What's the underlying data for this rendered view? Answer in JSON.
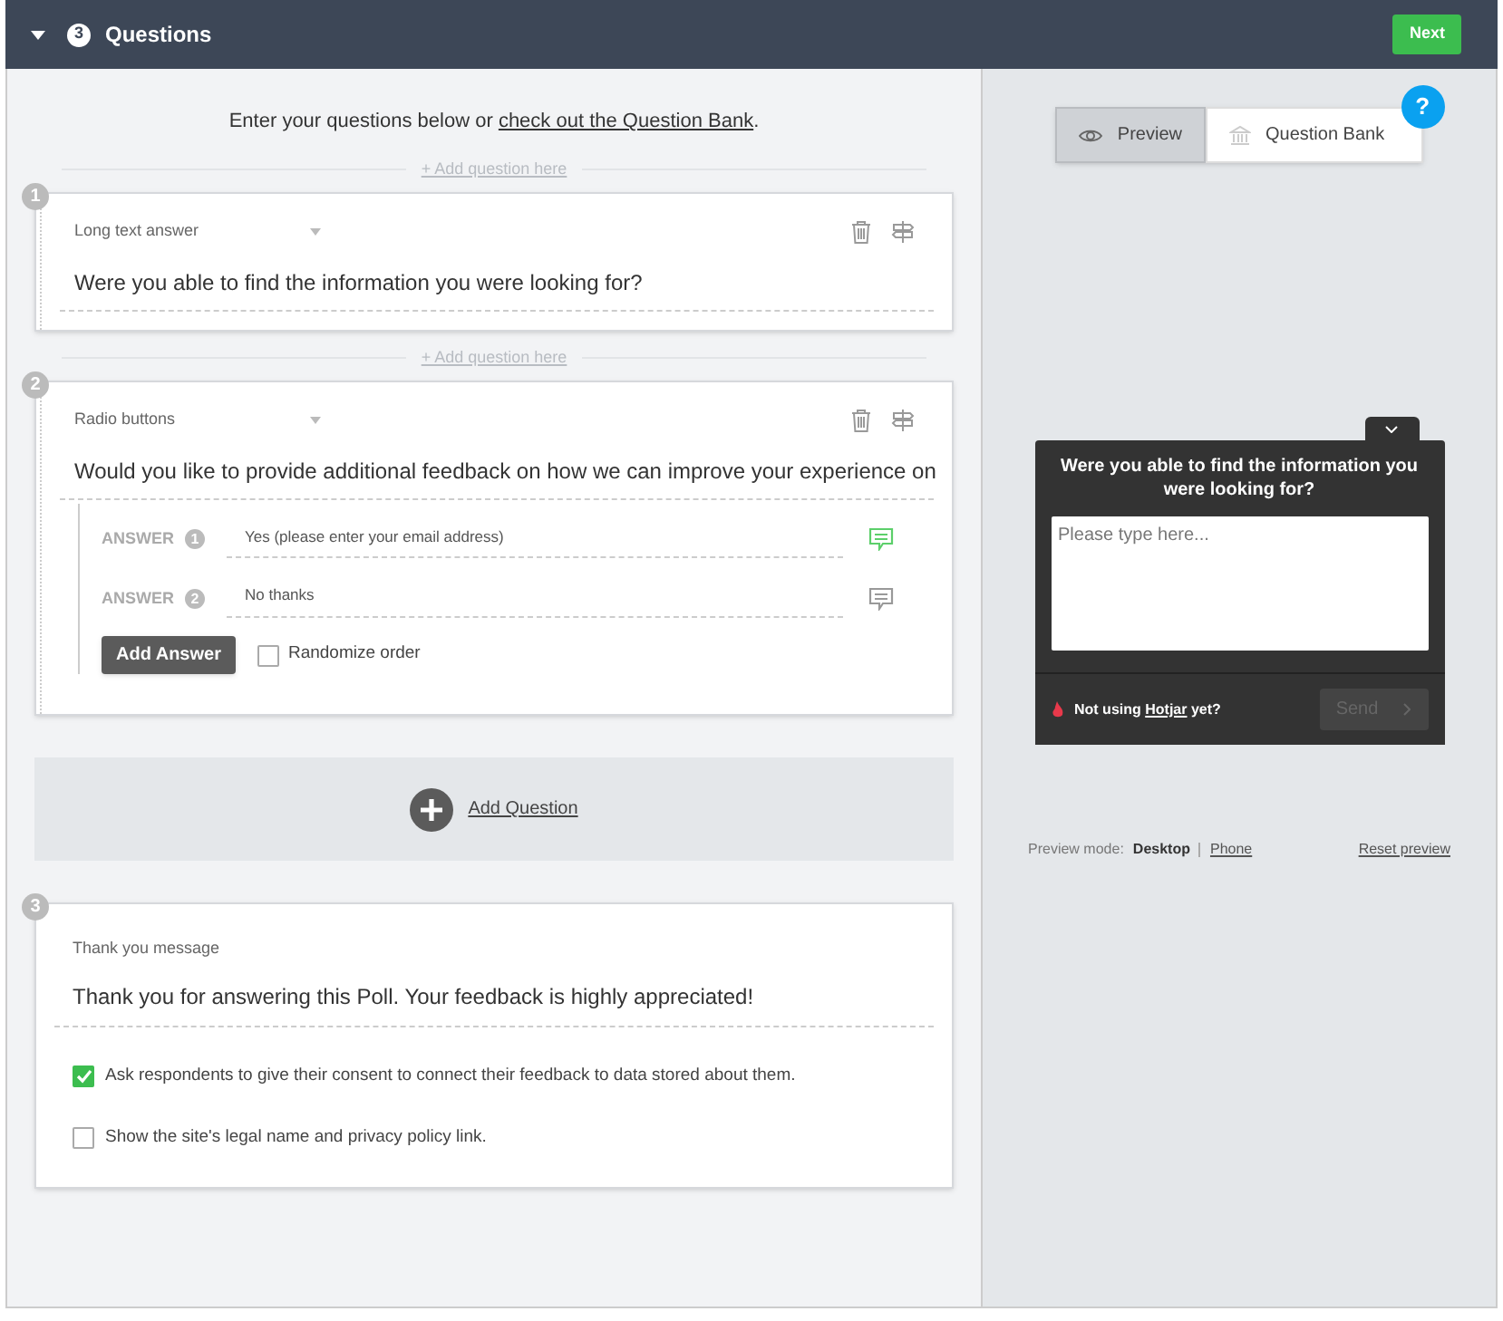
{
  "header": {
    "expanded": true,
    "step": "3",
    "title": "Questions",
    "next_button": "Next"
  },
  "intro": {
    "text": "Enter your questions below or ",
    "link": "check out the Question Bank",
    "end": "."
  },
  "questions": [
    {
      "insert_label": "+ Add question here",
      "number": "1",
      "type": "Long text answer",
      "text": "Were you able to find the information you were looking for?"
    },
    {
      "insert_label": "+ Add question here",
      "number": "2",
      "type": "Radio buttons",
      "text": "Would you like to provide additional feedback on how we can improve your experience on",
      "answers": [
        {
          "label": "ANSWER",
          "number": "1",
          "text": "Yes (please enter your email address)",
          "comment_on": true
        },
        {
          "label": "ANSWER",
          "number": "2",
          "text": "No thanks",
          "comment_on": false
        }
      ],
      "add_answer": "Add Answer",
      "randomize": {
        "label": "Randomize order",
        "checked": false
      }
    }
  ],
  "add_question": "Add Question",
  "thank_you": {
    "number": "3",
    "type": "Thank you message",
    "text": "Thank you for answering this Poll. Your feedback is highly appreciated!",
    "options": [
      {
        "label": "Ask respondents to give their consent to connect their feedback to data stored about them.",
        "checked": true
      },
      {
        "label": "Show the site's legal name and privacy policy link.",
        "checked": false
      }
    ]
  },
  "preview": {
    "tabs": [
      {
        "label": "Preview",
        "selected": true
      },
      {
        "label": "Question Bank",
        "selected": false
      }
    ],
    "help": "?",
    "widget": {
      "question": "Were you able to find the information you were looking for?",
      "placeholder": "Please type here...",
      "branding_prefix": "Not using ",
      "branding_link": "Hotjar",
      "branding_suffix": " yet?",
      "send": {
        "label": "Send",
        "disabled": true
      }
    },
    "mode_label": "Preview mode:",
    "modes": [
      {
        "label": "Desktop",
        "selected": true
      },
      {
        "label": "Phone",
        "selected": false
      }
    ],
    "reset": "Reset preview"
  }
}
